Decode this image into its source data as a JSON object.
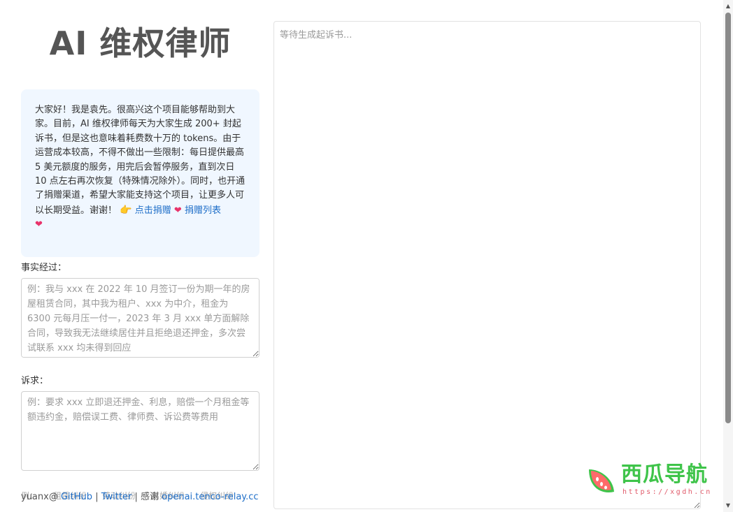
{
  "app": {
    "title": "AI 维权律师"
  },
  "notice": {
    "text": "大家好！我是袁先。很高兴这个项目能够帮助到大家。目前，AI 维权律师每天为大家生成 200+ 封起诉书，但是这也意味着耗费数十万的 tokens。由于运营成本较高，不得不做出一些限制：每日提供最高 5 美元额度的服务，用完后会暂停服务，直到次日 10 点左右再次恢复（特殊情况除外）。同时，也开通了捐赠渠道，希望大家能支持这个项目，让更多人可以长期受益。谢谢！",
    "hand_icon": "pointing-hand-icon",
    "donate_link": "点击捐赠",
    "heart_icon": "heart-icon",
    "donors_link": "捐赠列表",
    "heart_glyph": "❤",
    "hand_glyph": "👉"
  },
  "form": {
    "facts_label": "事实经过：",
    "facts_placeholder": "例：我与 xxx 在 2022 年 10 月签订一份为期一年的房屋租赁合同，其中我为租户、xxx 为中介，租金为 6300 元每月压一付一，2023 年 3 月 xxx 单方面解除合同，导致我无法继续居住并且拒绝退还押金，多次尝试联系 xxx 均未得到回应",
    "claims_label": "诉求：",
    "claims_placeholder": "例：要求 xxx 立即退还押金、利息，赔偿一个月租金等额违约金，赔偿误工费、律师费、诉讼费等费用"
  },
  "hidden_examples": {
    "prefix": "例：",
    "items": [
      "租赁纠纷",
      "劳动纠纷",
      "离婚纠纷",
      "侵权纠纷"
    ]
  },
  "footer": {
    "author": "yuanx@",
    "github": "GitHub",
    "separator": "|",
    "twitter": "Twitter",
    "thanks": "感谢",
    "relay": "openai.tenco-relay.cc"
  },
  "output": {
    "placeholder": "等待生成起诉书..."
  },
  "watermark": {
    "name": "西瓜导航",
    "url": "https://xgdh.cn"
  },
  "colors": {
    "link": "#1e6ec8",
    "notice_bg": "#f0f7ff",
    "heart": "#e8336b",
    "watermark_green": "#3fc44a",
    "watermark_red": "#e05b6a"
  }
}
